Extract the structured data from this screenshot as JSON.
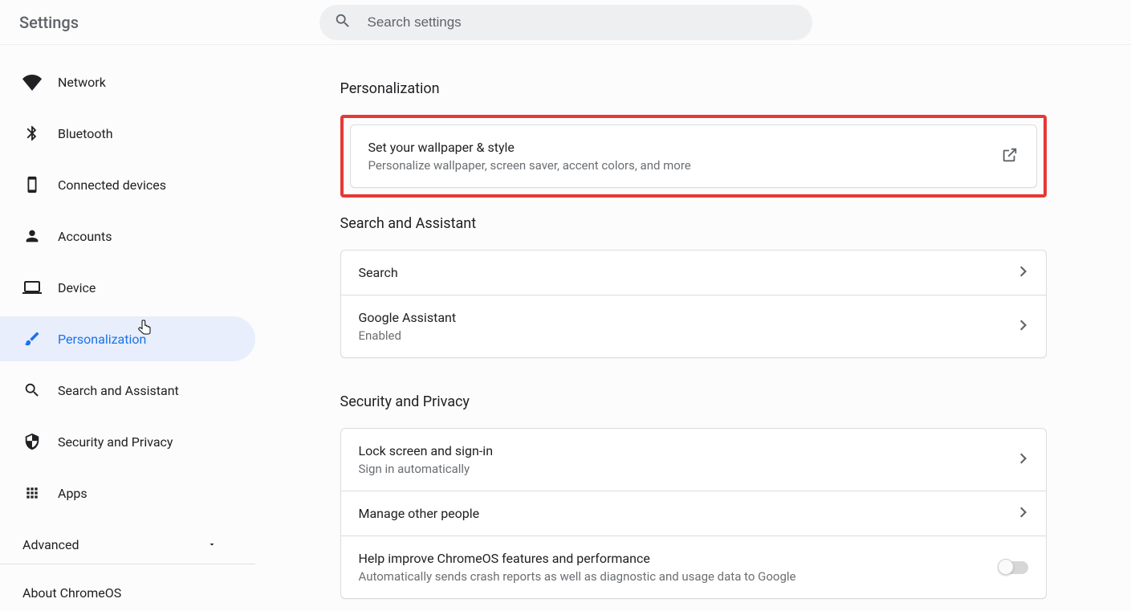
{
  "header": {
    "title": "Settings",
    "searchPlaceholder": "Search settings"
  },
  "sidebar": {
    "items": [
      {
        "id": "network",
        "label": "Network"
      },
      {
        "id": "bluetooth",
        "label": "Bluetooth"
      },
      {
        "id": "connected",
        "label": "Connected devices"
      },
      {
        "id": "accounts",
        "label": "Accounts"
      },
      {
        "id": "device",
        "label": "Device"
      },
      {
        "id": "personalization",
        "label": "Personalization"
      },
      {
        "id": "search",
        "label": "Search and Assistant"
      },
      {
        "id": "security",
        "label": "Security and Privacy"
      },
      {
        "id": "apps",
        "label": "Apps"
      }
    ],
    "selectedIndex": 5,
    "advanced": "Advanced",
    "about": "About ChromeOS"
  },
  "sections": {
    "personalization": {
      "title": "Personalization",
      "wallpaper": {
        "title": "Set your wallpaper & style",
        "sub": "Personalize wallpaper, screen saver, accent colors, and more"
      }
    },
    "searchAssistant": {
      "title": "Search and Assistant",
      "searchRow": {
        "title": "Search"
      },
      "assistantRow": {
        "title": "Google Assistant",
        "sub": "Enabled"
      }
    },
    "security": {
      "title": "Security and Privacy",
      "lockRow": {
        "title": "Lock screen and sign-in",
        "sub": "Sign in automatically"
      },
      "peopleRow": {
        "title": "Manage other people"
      },
      "improveRow": {
        "title": "Help improve ChromeOS features and performance",
        "sub": "Automatically sends crash reports as well as diagnostic and usage data to Google"
      }
    }
  }
}
